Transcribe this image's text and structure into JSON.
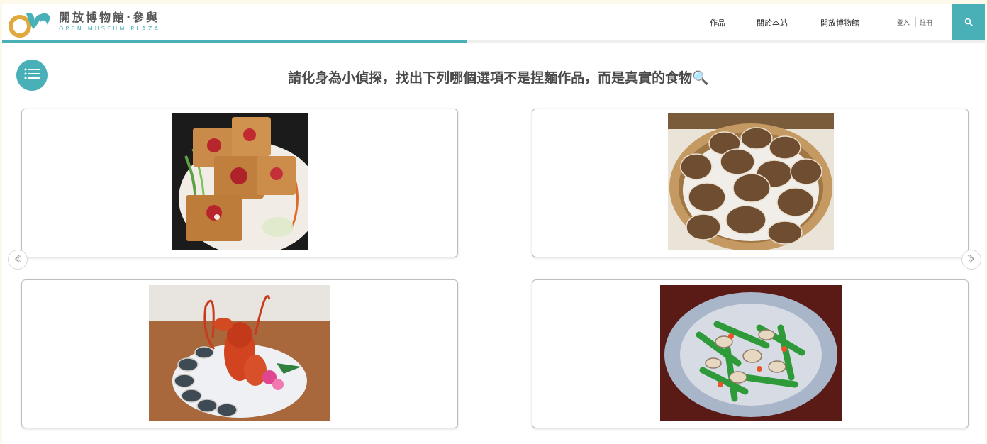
{
  "header": {
    "brand_cn": "開放博物館·參與",
    "brand_en": "OPEN MUSEUM PLAZA",
    "nav": [
      "作品",
      "關於本站",
      "開放博物館"
    ],
    "login": "登入",
    "register": "註冊",
    "accent_color": "#4ab0b8",
    "search_icon": "search-icon"
  },
  "main": {
    "menu_icon": "list-icon",
    "question": "請化身為小偵探，找出下列哪個選項不是捏麵作品，而是真實的食物🔍",
    "options": [
      {
        "subject": "fried tofu squares on plate"
      },
      {
        "subject": "shiitake mushrooms in bamboo steamer"
      },
      {
        "subject": "lobster platter with shellfish"
      },
      {
        "subject": "stir-fried snow peas with clams"
      }
    ],
    "prev_icon": "chevron-left-icon",
    "next_icon": "chevron-right-icon"
  }
}
